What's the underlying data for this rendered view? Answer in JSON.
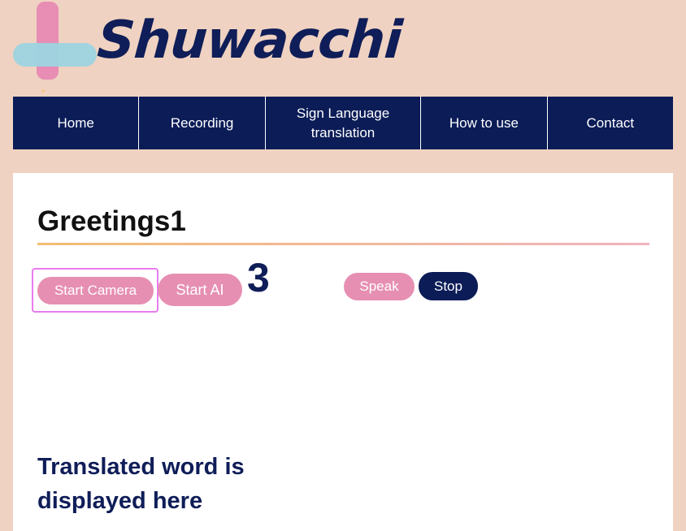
{
  "brand": {
    "name": "Shuwacchi",
    "logo_icon": "cross-logo-icon",
    "colors": {
      "background": "#efd2c1",
      "navy": "#0b1c57",
      "pink": "#e68fb2",
      "light_blue": "#9dd4e0"
    }
  },
  "nav": {
    "items": [
      {
        "label": "Home"
      },
      {
        "label": "Recording"
      },
      {
        "label": "Sign Language translation"
      },
      {
        "label": "How to use"
      },
      {
        "label": "Contact"
      }
    ]
  },
  "main": {
    "title": "Greetings1",
    "buttons": {
      "start_camera": "Start Camera",
      "start_ai": "Start AI",
      "speak": "Speak",
      "stop": "Stop"
    },
    "countdown": "3",
    "result_placeholder": "Translated word is displayed here"
  }
}
